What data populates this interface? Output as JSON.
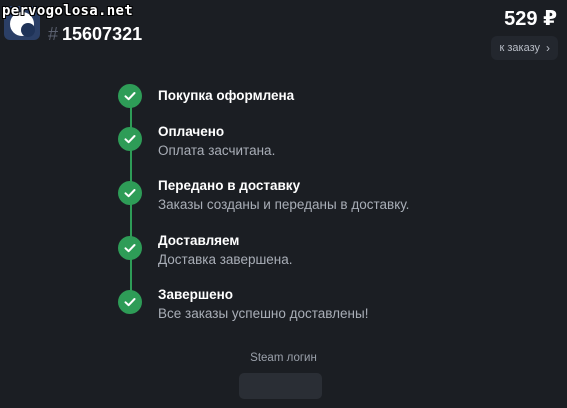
{
  "header": {
    "watermark": "pervogolosa.net",
    "order_hash": "#",
    "order_number": "15607321",
    "price": "529 ₽",
    "to_order_label": "к заказу"
  },
  "steps": [
    {
      "title": "Покупка оформлена",
      "desc": ""
    },
    {
      "title": "Оплачено",
      "desc": "Оплата засчитана."
    },
    {
      "title": "Передано в доставку",
      "desc": "Заказы созданы и переданы в доставку."
    },
    {
      "title": "Доставляем",
      "desc": "Доставка завершена."
    },
    {
      "title": "Завершено",
      "desc": "Все заказы успешно доставлены!"
    }
  ],
  "steam": {
    "label": "Steam логин",
    "value": ""
  },
  "colors": {
    "background": "#1b1e23",
    "accent_green": "#2e9c57",
    "muted_text": "#a9aeb7"
  }
}
